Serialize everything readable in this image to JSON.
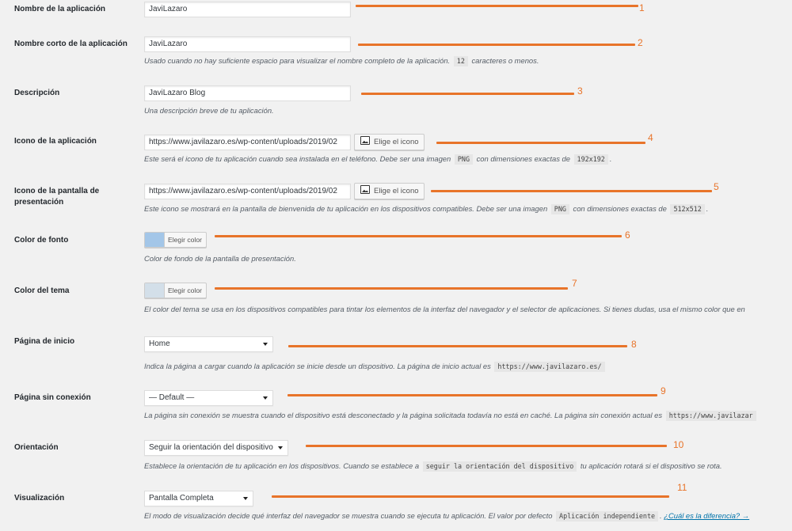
{
  "accent_color": "#e8742a",
  "fields": {
    "name": {
      "label": "Nombre de la aplicación",
      "value": "JaviLazaro",
      "marker": "1"
    },
    "short_name": {
      "label": "Nombre corto de la aplicación",
      "value": "JaviLazaro",
      "marker": "2",
      "desc_a": "Usado cuando no hay suficiente espacio para visualizar el nombre completo de la aplicación.",
      "desc_code": "12",
      "desc_b": "caracteres o menos."
    },
    "description": {
      "label": "Descripción",
      "value": "JaviLazaro Blog",
      "marker": "3",
      "desc": "Una descripción breve de tu aplicación."
    },
    "app_icon": {
      "label": "Icono de la aplicación",
      "value": "https://www.javilazaro.es/wp-content/uploads/2019/02",
      "button": "Elige el icono",
      "marker": "4",
      "desc_a": "Este será el icono de tu aplicación cuando sea instalada en el teléfono. Debe ser una imagen",
      "code_1": "PNG",
      "desc_b": "con dimensiones exactas de",
      "code_2": "192x192",
      "desc_c": "."
    },
    "splash_icon": {
      "label": "Icono de la pantalla de presentación",
      "value": "https://www.javilazaro.es/wp-content/uploads/2019/02",
      "button": "Elige el icono",
      "marker": "5",
      "desc_a": "Este icono se mostrará en la pantalla de bienvenida de tu aplicación en los dispositivos compatibles. Debe ser una imagen",
      "code_1": "PNG",
      "desc_b": "con dimensiones exactas de",
      "code_2": "512x512",
      "desc_c": "."
    },
    "background_color": {
      "label": "Color de fonto",
      "button": "Elegir color",
      "swatch": "#a3c6e8",
      "marker": "6",
      "desc": "Color de fondo de la pantalla de presentación."
    },
    "theme_color": {
      "label": "Color del tema",
      "button": "Elegir color",
      "swatch": "#d3dfe9",
      "marker": "7",
      "desc": "El color del tema se usa en los dispositivos compatibles para tintar los elementos de la interfaz del navegador y el selector de aplicaciones. Si tienes dudas, usa el mismo color que en"
    },
    "start_page": {
      "label": "Página de inicio",
      "value": "Home",
      "marker": "8",
      "desc_a": "Indica la página a cargar cuando la aplicación se inicie desde un dispositivo. La página de inicio actual es",
      "desc_code": "https://www.javilazaro.es/"
    },
    "offline_page": {
      "label": "Página sin conexión",
      "value": "— Default —",
      "marker": "9",
      "desc_a": "La página sin conexión se muestra cuando el dispositivo está desconectado y la página solicitada todavía no está en caché. La página sin conexión actual es",
      "desc_code": "https://www.javilazar"
    },
    "orientation": {
      "label": "Orientación",
      "value": "Seguir la orientación del dispositivo",
      "marker": "10",
      "desc_a": "Establece la orientación de tu aplicación en los dispositivos. Cuando se establece a",
      "desc_code": "seguir la orientación del dispositivo",
      "desc_b": "tu aplicación rotará si el dispositivo se rota."
    },
    "display": {
      "label": "Visualización",
      "value": "Pantalla Completa",
      "marker": "11",
      "desc_a": "El modo de visualización decide qué interfaz del navegador se muestra cuando se ejecuta tu aplicación. El valor por defecto",
      "desc_code": "Aplicación independiente",
      "desc_b": ".",
      "link": "¿Cuál es la diferencia? →"
    }
  }
}
